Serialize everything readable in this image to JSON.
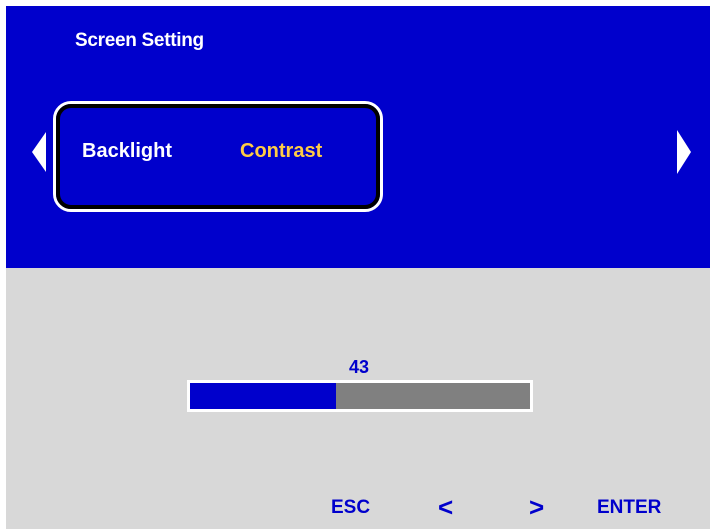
{
  "header": {
    "title": "Screen Setting"
  },
  "tabs": [
    {
      "label": "Backlight",
      "selected": false
    },
    {
      "label": "Contrast",
      "selected": true
    }
  ],
  "slider": {
    "value": "43",
    "fraction": 0.43
  },
  "footer": {
    "esc_label": "ESC",
    "prev_label": "<",
    "next_label": ">",
    "enter_label": "ENTER"
  },
  "colors": {
    "panel_blue": "#0000cc",
    "panel_gray": "#d8d8d8",
    "selected_tab": "#ffcc44",
    "slider_empty": "#808080"
  },
  "icons": {
    "left_arrow": "triangle-left-icon",
    "right_arrow": "triangle-right-icon"
  }
}
